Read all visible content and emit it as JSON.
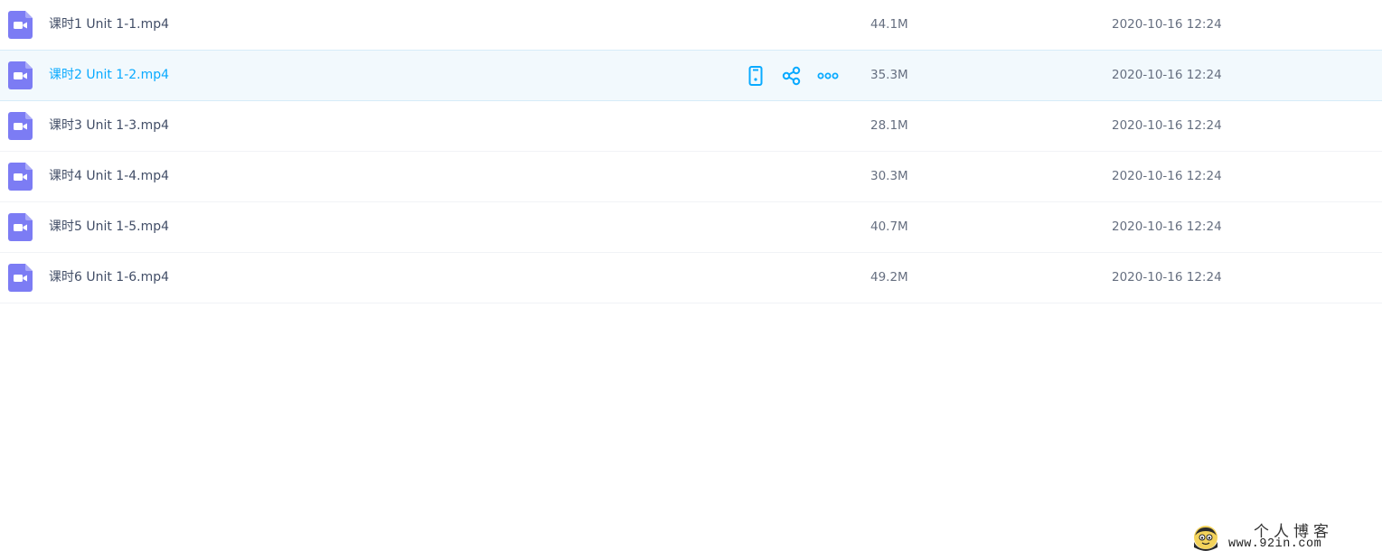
{
  "files": [
    {
      "name": "课时1 Unit 1-1.mp4",
      "size": "44.1M",
      "date": "2020-10-16 12:24"
    },
    {
      "name": "课时2 Unit 1-2.mp4",
      "size": "35.3M",
      "date": "2020-10-16 12:24"
    },
    {
      "name": "课时3 Unit 1-3.mp4",
      "size": "28.1M",
      "date": "2020-10-16 12:24"
    },
    {
      "name": "课时4 Unit 1-4.mp4",
      "size": "30.3M",
      "date": "2020-10-16 12:24"
    },
    {
      "name": "课时5 Unit 1-5.mp4",
      "size": "40.7M",
      "date": "2020-10-16 12:24"
    },
    {
      "name": "课时6 Unit 1-6.mp4",
      "size": "49.2M",
      "date": "2020-10-16 12:24"
    }
  ],
  "icons": {
    "file_type": "video-file-icon",
    "row_actions": [
      "phone-icon",
      "share-icon",
      "more-icon"
    ]
  },
  "colors": {
    "video_icon": "#7c7cf4",
    "accent": "#09aaff",
    "hover_bg": "#f2f9fd"
  },
  "watermark": {
    "title": "个人博客",
    "url": "www.92in.com"
  }
}
